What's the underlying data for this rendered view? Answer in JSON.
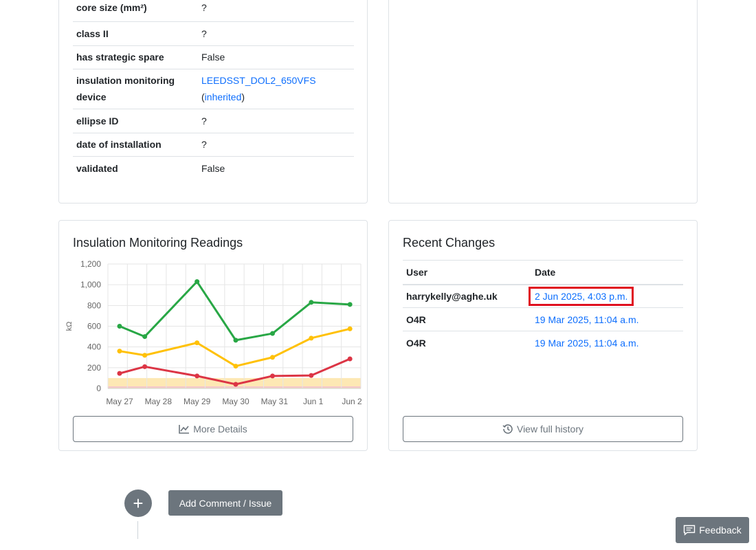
{
  "properties": [
    {
      "label": "core size (mm²)",
      "value": "?"
    },
    {
      "label": "class II",
      "value": "?"
    },
    {
      "label": "has strategic spare",
      "value": "False"
    },
    {
      "label": "insulation monitoring device",
      "link": "LEEDSST_DOL2_650VFS",
      "inherited": "inherited"
    },
    {
      "label": "ellipse ID",
      "value": "?"
    },
    {
      "label": "date of installation",
      "value": "?"
    },
    {
      "label": "validated",
      "value": "False"
    }
  ],
  "chart_card": {
    "title": "Insulation Monitoring Readings",
    "more_details_label": "More Details"
  },
  "chart_data": {
    "type": "line",
    "categories": [
      "May 27",
      "May 28",
      "May 29",
      "May 30",
      "May 31",
      "Jun 1",
      "Jun 2"
    ],
    "x": [
      0,
      0.65,
      2.0,
      3.0,
      3.95,
      4.95,
      5.95
    ],
    "ylabel": "kΩ",
    "ylim": [
      0,
      1200
    ],
    "yticks": [
      "0",
      "200",
      "400",
      "600",
      "800",
      "1,000",
      "1,200"
    ],
    "grid": true,
    "band": [
      0,
      100
    ],
    "series": [
      {
        "color": "#28a745",
        "values": [
          600,
          500,
          1030,
          465,
          530,
          830,
          810
        ]
      },
      {
        "color": "#ffc107",
        "values": [
          360,
          320,
          440,
          215,
          300,
          485,
          575
        ]
      },
      {
        "color": "#dc3545",
        "values": [
          145,
          210,
          120,
          40,
          120,
          125,
          285
        ]
      }
    ]
  },
  "changes_card": {
    "title": "Recent Changes",
    "col_user": "User",
    "col_date": "Date",
    "rows": [
      {
        "user": "harrykelly@aghe.uk",
        "date": "2 Jun 2025, 4:03 p.m."
      },
      {
        "user": "O4R",
        "date": "19 Mar 2025, 11:04 a.m."
      },
      {
        "user": "O4R",
        "date": "19 Mar 2025, 11:04 a.m."
      }
    ],
    "view_history_label": "View full history"
  },
  "bottom": {
    "add_comment_label": "Add Comment / Issue",
    "plus_icon": "+",
    "feedback_label": "Feedback"
  }
}
